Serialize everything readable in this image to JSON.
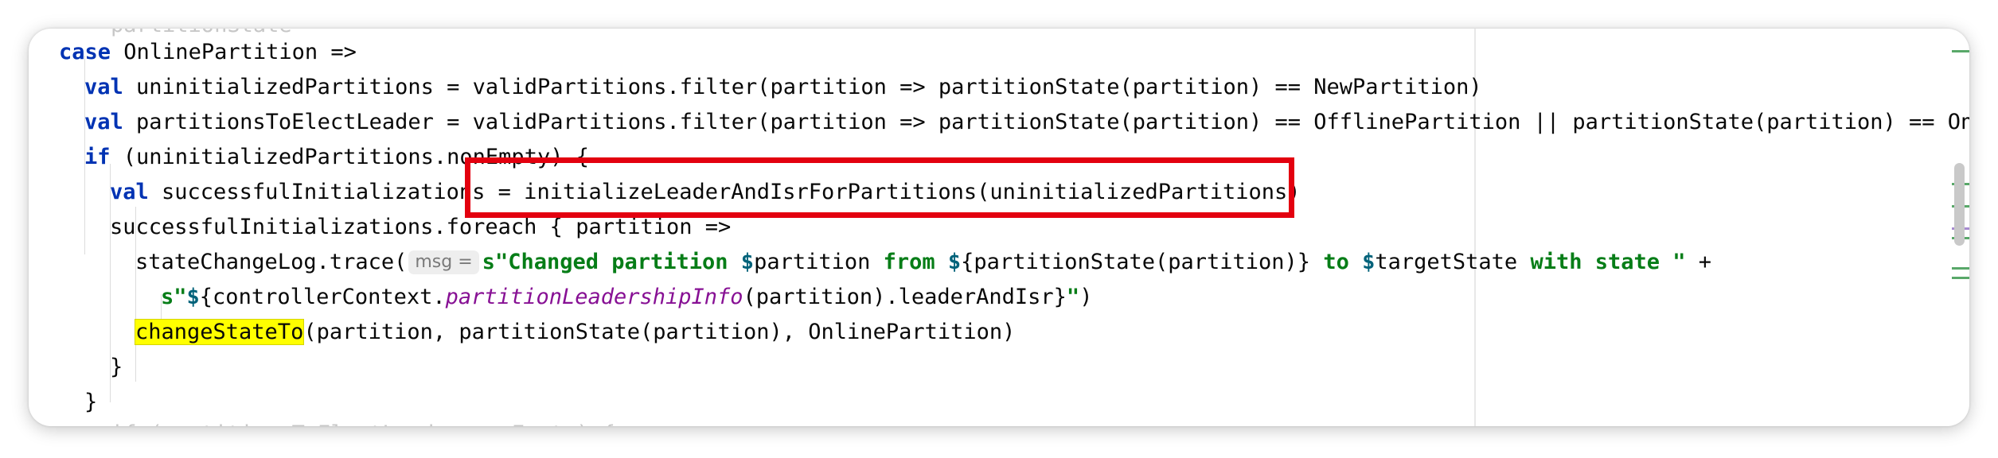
{
  "editor": {
    "lines": {
      "top_cut": "    partitionState",
      "l1_kw": "case",
      "l1_rest": " OnlinePartition =>",
      "l2_kw": "val",
      "l2_rest": " uninitializedPartitions = validPartitions.filter(partition => partitionState(partition) == NewPartition)",
      "l3_kw": "val",
      "l3_rest": " partitionsToElectLeader = validPartitions.filter(partition => partitionState(partition) == OfflinePartition || partitionState(partition) == OnlinePa",
      "l4_kw": "if",
      "l4_rest": " (uninitializedPartitions.nonEmpty) {",
      "l5_kw": "val",
      "l5_rest": " successfulInitializations = initializeLeaderAndIsrForPartitions(uninitializedPartitions)",
      "l6_text": "successfulInitializations.foreach { partition =>",
      "l7_call": "stateChangeLog.trace(",
      "l7_hint": "msg =",
      "l7_s": "s",
      "l7_str1": "\"Changed partition ",
      "l7_d1": "$",
      "l7_t1": "partition ",
      "l7_str2": "from ",
      "l7_d2": "$",
      "l7_t2": "{partitionState(partition)} ",
      "l7_str3": "to ",
      "l7_d3": "$",
      "l7_t3": "targetState ",
      "l7_str4": "with state \"",
      "l7_plus": " +",
      "l8_s": "s",
      "l8_q1": "\"",
      "l8_d": "$",
      "l8_t1": "{controllerContext.",
      "l8_member": "partitionLeadershipInfo",
      "l8_t2": "(partition).leaderAndIsr}",
      "l8_q2": "\"",
      "l8_close": ")",
      "l9_highlight": "changeStateTo",
      "l9_rest": "(partition, partitionState(partition), OnlinePartition)",
      "l10": "}",
      "l11": "}",
      "bottom_cut": "    if (partitionsToElectLeader.nonEmpty) {"
    }
  },
  "colors": {
    "keyword": "#0033b3",
    "string": "#067d17",
    "interpolation": "#00627a",
    "member": "#871094",
    "highlight": "#ffff00",
    "annotation_box": "#e3000f"
  }
}
